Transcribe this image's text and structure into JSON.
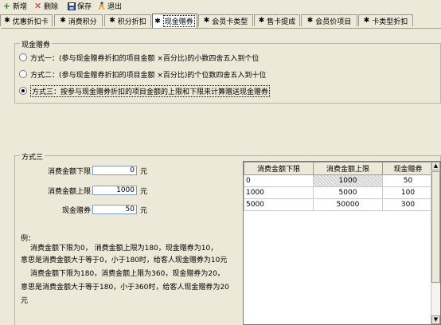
{
  "toolbar": {
    "new": "新增",
    "delete": "删除",
    "save": "保存",
    "exit": "退出"
  },
  "tabs": [
    "优惠折扣卡",
    "消费积分",
    "积分折扣",
    "现金赠券",
    "会员卡类型",
    "售卡提成",
    "会员价项目",
    "卡类型折扣"
  ],
  "active_tab": "现金赠券",
  "cash_group": {
    "title": "现金赠券",
    "options": [
      "方式一：(参与现金赠券折扣的项目金额 ×百分比)的小数四舍五入到个位",
      "方式二：(参与现金赠券折扣的项目金额 ×百分比)的个位数四舍五入到十位",
      "方式三：按参与现金赠券折扣的项目金额的上限和下限来计算赠送现金赠券"
    ],
    "selected_index": 2
  },
  "method3": {
    "title": "方式三",
    "fields": [
      {
        "label": "消费金额下限",
        "value": "0",
        "unit": "元"
      },
      {
        "label": "消费金额上限",
        "value": "1000",
        "unit": "元"
      },
      {
        "label": "现金赠券",
        "value": "50",
        "unit": "元"
      }
    ],
    "example": [
      "例：",
      "消费金额下限为0， 消费金额上限为180，现金赠券为10，",
      "意思是消费金额大于等于0，小于180时，给客人现金赠券为10元",
      "消费金额下限为180，消费金额上限为360，现金赠券为20，",
      "意思是消费金额大于等于180，小于360时，给客人现金赠券为20",
      "元"
    ]
  },
  "table": {
    "columns": [
      "消费金额下限",
      "消费金额上限",
      "现金赠券"
    ],
    "rows": [
      [
        "0",
        "1000",
        "50"
      ],
      [
        "1000",
        "5000",
        "100"
      ],
      [
        "5000",
        "50000",
        "300"
      ]
    ]
  }
}
